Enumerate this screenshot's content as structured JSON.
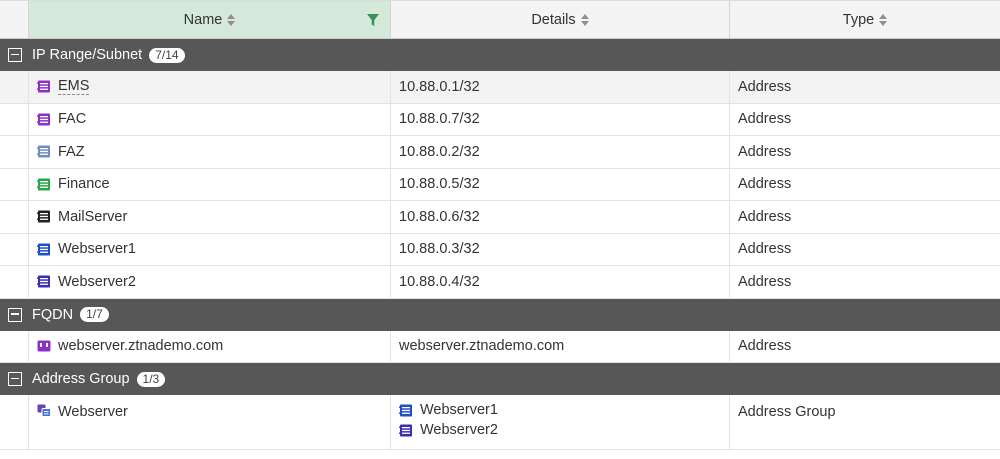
{
  "headers": {
    "name": "Name",
    "details": "Details",
    "type": "Type"
  },
  "colors": {
    "header_active": "#d5e9da",
    "group_bar": "#575757",
    "filter": "#3b8f5a"
  },
  "groups": [
    {
      "title": "IP Range/Subnet",
      "count": "7/14",
      "rows": [
        {
          "name": "EMS",
          "details": "10.88.0.1/32",
          "type": "Address",
          "icon_color": "#8b31c7"
        },
        {
          "name": "FAC",
          "details": "10.88.0.7/32",
          "type": "Address",
          "icon_color": "#8b31c7"
        },
        {
          "name": "FAZ",
          "details": "10.88.0.2/32",
          "type": "Address",
          "icon_color": "#6f8fbf"
        },
        {
          "name": "Finance",
          "details": "10.88.0.5/32",
          "type": "Address",
          "icon_color": "#2aa54a"
        },
        {
          "name": "MailServer",
          "details": "10.88.0.6/32",
          "type": "Address",
          "icon_color": "#222222"
        },
        {
          "name": "Webserver1",
          "details": "10.88.0.3/32",
          "type": "Address",
          "icon_color": "#1f4fc7"
        },
        {
          "name": "Webserver2",
          "details": "10.88.0.4/32",
          "type": "Address",
          "icon_color": "#3a2fb0"
        }
      ]
    },
    {
      "title": "FQDN",
      "count": "1/7",
      "rows": [
        {
          "name": "webserver.ztnademo.com",
          "details": "webserver.ztnademo.com",
          "type": "Address",
          "icon_color": "#8b31c7"
        }
      ]
    },
    {
      "title": "Address Group",
      "count": "1/3",
      "rows": [
        {
          "name": "Webserver",
          "members": [
            "Webserver1",
            "Webserver2"
          ],
          "type": "Address Group",
          "icon_color": "#6a3fb8"
        }
      ]
    }
  ]
}
